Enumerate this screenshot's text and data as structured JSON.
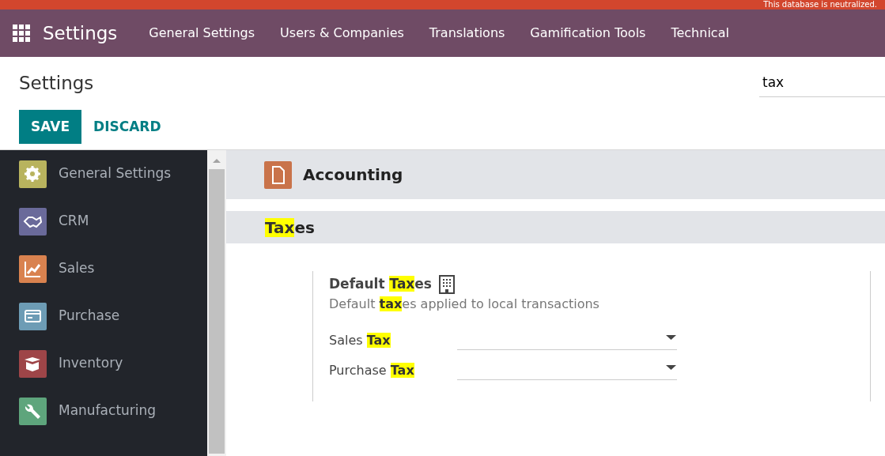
{
  "banner": {
    "text": "This database is neutralized."
  },
  "navbar": {
    "app": "Settings",
    "menus": [
      "General Settings",
      "Users & Companies",
      "Translations",
      "Gamification Tools",
      "Technical"
    ]
  },
  "control_panel": {
    "title": "Settings",
    "search": {
      "value": "tax"
    },
    "buttons": [
      {
        "label": "SAVE",
        "kind": "primary"
      },
      {
        "label": "DISCARD",
        "kind": "link"
      }
    ]
  },
  "sidebar": {
    "items": [
      {
        "label": "General Settings",
        "color": "#b8b35e"
      },
      {
        "label": "CRM",
        "color": "#6a6a9a"
      },
      {
        "label": "Sales",
        "color": "#d9824f"
      },
      {
        "label": "Purchase",
        "color": "#6d9cb5"
      },
      {
        "label": "Inventory",
        "color": "#9e4548"
      },
      {
        "label": "Manufacturing",
        "color": "#5ea57c"
      }
    ]
  },
  "app_section": {
    "title": "Accounting"
  },
  "group": {
    "title": "**Tax**es"
  },
  "setting": {
    "title": "Default **Tax**es",
    "description": "Default **tax**es applied to local transactions",
    "fields": [
      {
        "label": "Sales **Tax**"
      },
      {
        "label": "Purchase **Tax**"
      }
    ]
  }
}
